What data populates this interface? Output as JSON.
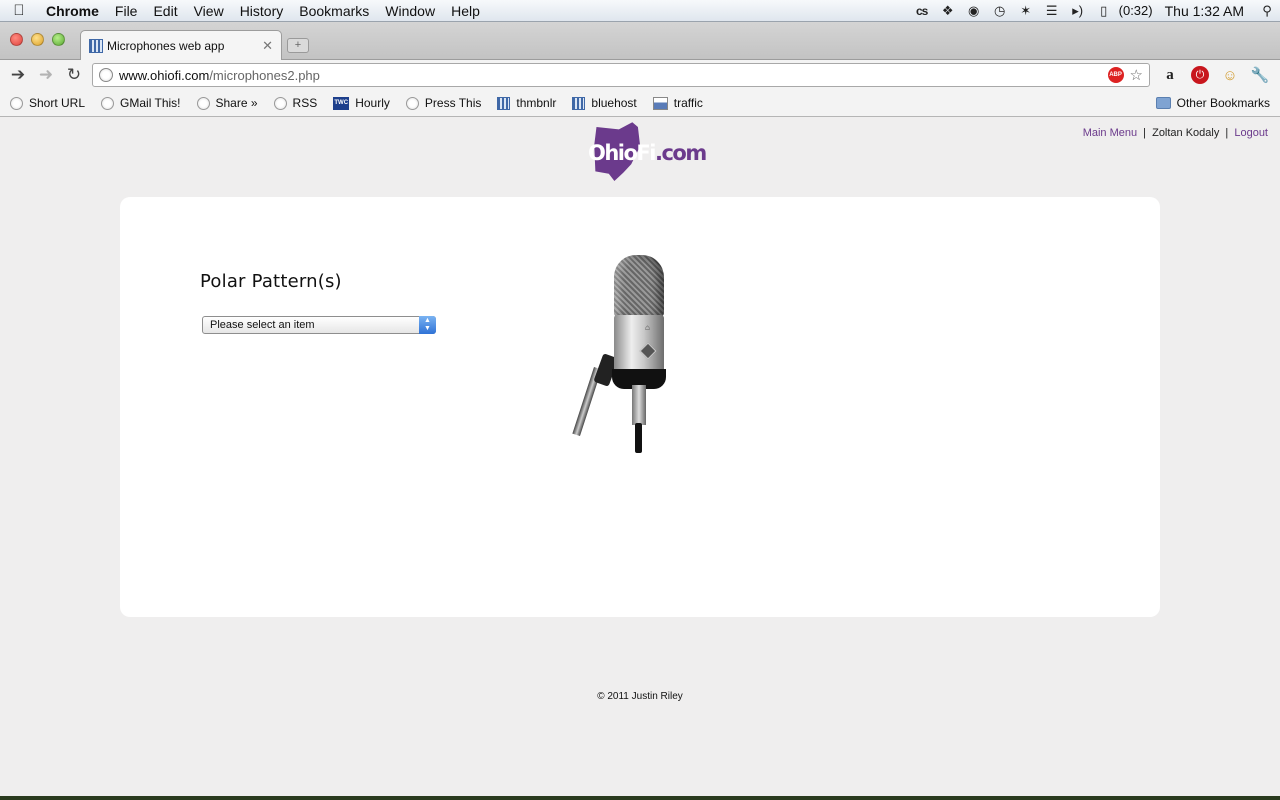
{
  "menubar": {
    "app": "Chrome",
    "menus": [
      "File",
      "Edit",
      "View",
      "History",
      "Bookmarks",
      "Window",
      "Help"
    ],
    "status_icons": [
      "cs-icon",
      "dropbox-icon",
      "notification-icon",
      "time-machine-icon",
      "bluetooth-icon",
      "wifi-icon",
      "volume-icon",
      "battery-icon"
    ],
    "battery": "(0:32)",
    "clock": "Thu 1:32 AM"
  },
  "browser": {
    "tab_title": "Microphones web app",
    "url_host": "www.ohiofi.com",
    "url_path": "/microphones2.php",
    "bookmarks": [
      {
        "label": "Short URL",
        "icon": "globe-icon"
      },
      {
        "label": "GMail This!",
        "icon": "globe-icon"
      },
      {
        "label": "Share »",
        "icon": "globe-icon"
      },
      {
        "label": "RSS",
        "icon": "globe-icon"
      },
      {
        "label": "Hourly",
        "icon": "twc-icon"
      },
      {
        "label": "Press This",
        "icon": "globe-icon"
      },
      {
        "label": "thmbnlr",
        "icon": "grid-icon"
      },
      {
        "label": "bluehost",
        "icon": "grid-icon"
      },
      {
        "label": "traffic",
        "icon": "traffic-icon"
      }
    ],
    "other_bookmarks": "Other Bookmarks"
  },
  "page": {
    "logo": {
      "part1": "OhioFi",
      "part2": ".com"
    },
    "nav": {
      "main_menu": "Main Menu",
      "sep1": "|",
      "user": "Zoltan Kodaly",
      "sep2": "|",
      "logout": "Logout"
    },
    "field_label": "Polar Pattern(s)",
    "select": {
      "value": "Please select an item"
    },
    "footer": "© 2011 Justin Riley"
  },
  "colors": {
    "brand": "#6b3a8c",
    "card": "#ffffff",
    "background": "#efeeee"
  }
}
